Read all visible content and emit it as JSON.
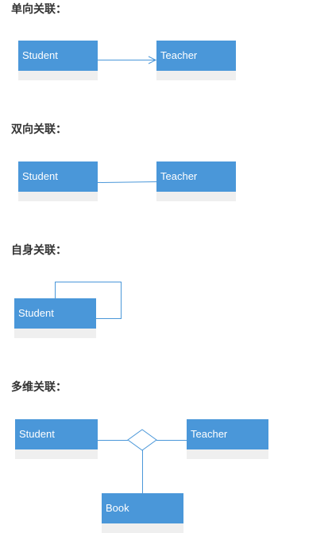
{
  "sections": {
    "unidirectional": {
      "title": "单向关联：",
      "left_class": "Student",
      "right_class": "Teacher"
    },
    "bidirectional": {
      "title": "双向关联：",
      "left_class": "Student",
      "right_class": "Teacher"
    },
    "self": {
      "title": "自身关联：",
      "class": "Student"
    },
    "multi": {
      "title": "多维关联：",
      "left_class": "Student",
      "right_class": "Teacher",
      "bottom_class": "Book"
    }
  },
  "colors": {
    "class_fill": "#4a97d9",
    "class_body": "#efefef",
    "line": "#4a97d9",
    "heading": "#333333"
  }
}
